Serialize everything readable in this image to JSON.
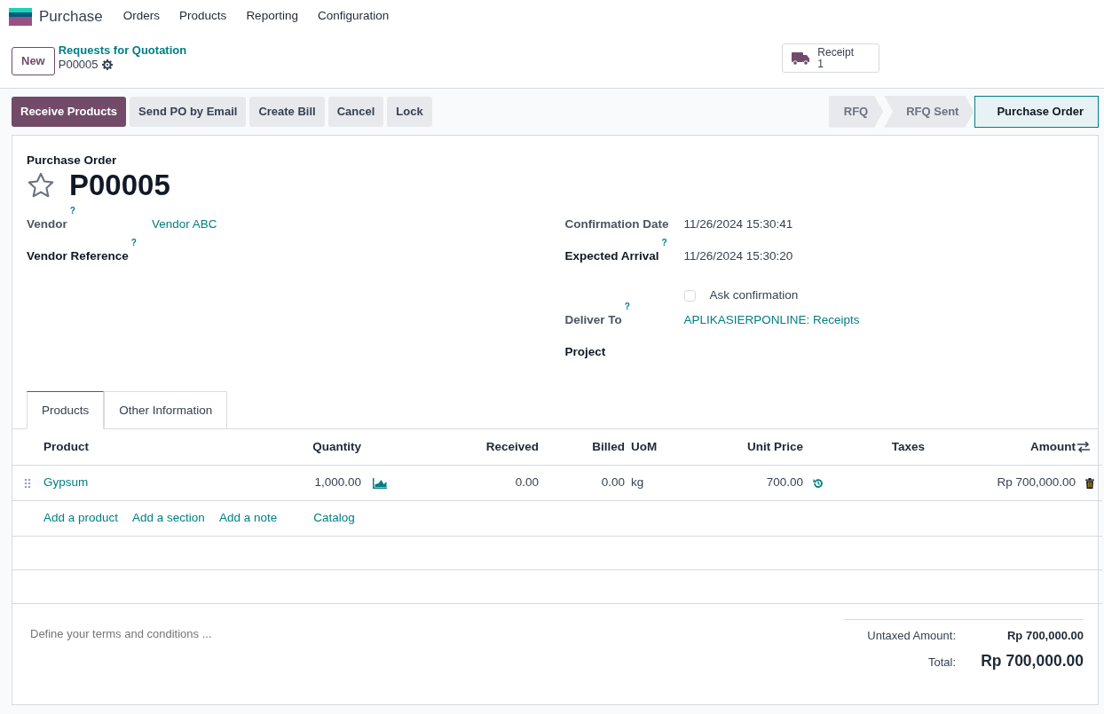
{
  "app": {
    "name": "Purchase",
    "menu": [
      "Orders",
      "Products",
      "Reporting",
      "Configuration"
    ]
  },
  "control_panel": {
    "new_button": "New",
    "breadcrumb": "Requests for Quotation",
    "record": "P00005",
    "smart_button": {
      "label": "Receipt",
      "count": "1"
    }
  },
  "actions": [
    {
      "label": "Receive Products",
      "primary": true
    },
    {
      "label": "Send PO by Email",
      "primary": false
    },
    {
      "label": "Create Bill",
      "primary": false
    },
    {
      "label": "Cancel",
      "primary": false
    },
    {
      "label": "Lock",
      "primary": false
    }
  ],
  "statusbar": [
    {
      "label": "RFQ",
      "selected": false
    },
    {
      "label": "RFQ Sent",
      "selected": false
    },
    {
      "label": "Purchase Order",
      "selected": true
    }
  ],
  "form": {
    "title_label": "Purchase Order",
    "name": "P00005",
    "starred": false,
    "left_fields": [
      {
        "kind": "field",
        "label": "Vendor",
        "help": "?",
        "required": false,
        "value": "Vendor ABC",
        "link": true
      },
      {
        "kind": "field",
        "label": "Vendor Reference",
        "help": "?",
        "required": true
      }
    ],
    "right_fields": [
      {
        "kind": "field",
        "label": "Confirmation Date",
        "required": false,
        "value": "11/26/2024 15:30:41",
        "link": false
      },
      {
        "kind": "field",
        "label": "Expected Arrival",
        "help": "?",
        "required": true,
        "value": "11/26/2024 15:30:20",
        "link": false
      },
      {
        "kind": "checkbox",
        "label": "Ask confirmation",
        "checked": false
      },
      {
        "kind": "field",
        "label": "Deliver To",
        "help": "?",
        "required": false,
        "value": "APLIKASIERPONLINE: Receipts",
        "link": true
      },
      {
        "kind": "field",
        "label": "Project",
        "required": true
      }
    ]
  },
  "tabs": [
    {
      "label": "Products",
      "selected": true
    },
    {
      "label": "Other Information",
      "selected": false
    }
  ],
  "table": {
    "columns": [
      "Product",
      "Quantity",
      "Received",
      "Billed",
      "UoM",
      "Unit Price",
      "Taxes",
      "Amount"
    ],
    "rows": [
      {
        "product": "Gypsum",
        "quantity": "1,000.00",
        "received": "0.00",
        "billed": "0.00",
        "uom": "kg",
        "unit_price": "700.00",
        "taxes": "",
        "amount": "Rp 700,000.00"
      }
    ],
    "add_links": [
      "Add a product",
      "Add a section",
      "Add a note",
      "Catalog"
    ]
  },
  "notes": {
    "placeholder": "Define your terms and conditions ..."
  },
  "totals": [
    {
      "label": "Untaxed Amount:",
      "value": "Rp 700,000.00",
      "grand": false
    },
    {
      "label": "Total:",
      "value": "Rp 700,000.00",
      "grand": true
    }
  ]
}
